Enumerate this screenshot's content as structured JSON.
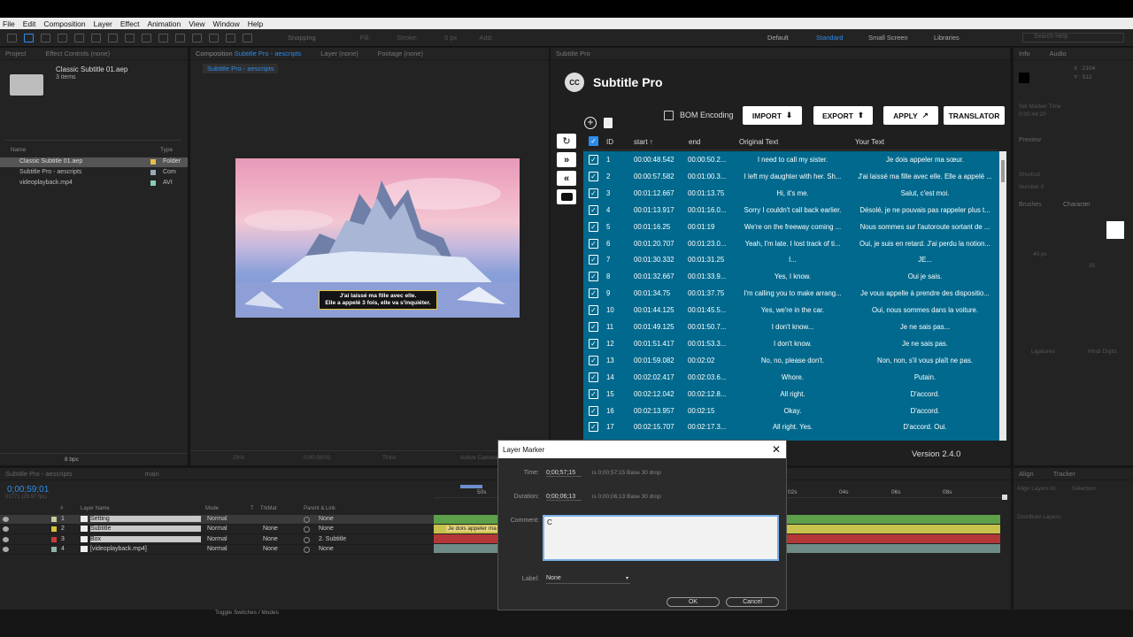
{
  "menu": [
    "File",
    "Edit",
    "Composition",
    "Layer",
    "Effect",
    "Animation",
    "View",
    "Window",
    "Help"
  ],
  "toolbar": {
    "snapping": "Snapping",
    "fill": "Fill:",
    "stroke": "Stroke:",
    "stroke_px": "0 px",
    "add": "Add:"
  },
  "workspaces": [
    "Default",
    "Standard",
    "Small Screen",
    "Libraries"
  ],
  "search_help": "Search Help",
  "project": {
    "tab": "Project",
    "tab2": "Effect Controls (none)",
    "comp_name": "Classic Subtitle 01.aep",
    "comp_items": "3 items",
    "col_name": "Name",
    "col_type": "Type",
    "items": [
      {
        "name": "Classic Subtitle 01.aep",
        "type": "Folder"
      },
      {
        "name": "Subtitle Pro - aescripts",
        "type": "Com"
      },
      {
        "name": "videoplayback.mp4",
        "type": "AVI"
      }
    ],
    "bpc": "8 bpc"
  },
  "viewer": {
    "tab_comp": "Composition",
    "tab_comp_name": "Subtitle Pro - aescripts",
    "tab_layer": "Layer (none)",
    "tab_footage": "Footage (none)",
    "breadcrumb": "Subtitle Pro - aescripts",
    "subtitle_line1": "J'ai laissé ma fille avec elle.",
    "subtitle_line2": "Elle a appelé 3 fois, elle va s'inquiéter.",
    "zoom": "25%",
    "timecode": "0;00;59;01",
    "res": "Third",
    "camera": "Active Camera"
  },
  "subtitle_pro": {
    "tab": "Subtitle Pro",
    "logo": "CC",
    "title": "Subtitle Pro",
    "bom": "BOM Encoding",
    "import": "IMPORT",
    "export": "EXPORT",
    "apply": "APPLY",
    "translator": "TRANSLATOR",
    "columns": {
      "id": "ID",
      "start": "start",
      "end": "end",
      "original": "Original Text",
      "yours": "Your Text"
    },
    "rows": [
      {
        "id": "1",
        "start": "00:00:48.542",
        "end": "00:00:50.2...",
        "orig": "I need to call my sister.",
        "tr": "Je dois appeler ma sœur."
      },
      {
        "id": "2",
        "start": "00:00:57.582",
        "end": "00:01:00.3...",
        "orig": "I left my daughter with her. Sh...",
        "tr": "J'ai laissé ma fille avec elle. Elle a appelé ..."
      },
      {
        "id": "3",
        "start": "00:01:12.667",
        "end": "00:01:13.75",
        "orig": "Hi, it's me.",
        "tr": "Salut, c'est moi."
      },
      {
        "id": "4",
        "start": "00:01:13.917",
        "end": "00:01:16.0...",
        "orig": "Sorry I couldn't call back earlier.",
        "tr": "Désolé, je ne pouvais pas rappeler plus t..."
      },
      {
        "id": "5",
        "start": "00:01:16.25",
        "end": "00:01:19",
        "orig": "We're on the freeway coming ...",
        "tr": "Nous sommes sur l'autoroute sortant de ..."
      },
      {
        "id": "6",
        "start": "00:01:20.707",
        "end": "00:01:23.0...",
        "orig": "Yeah, I'm late. I lost track of ti...",
        "tr": "Oui, je suis en retard. J'ai perdu la notion..."
      },
      {
        "id": "7",
        "start": "00:01:30.332",
        "end": "00:01:31.25",
        "orig": "I...",
        "tr": "JE..."
      },
      {
        "id": "8",
        "start": "00:01:32.667",
        "end": "00:01:33.9...",
        "orig": "Yes, I know.",
        "tr": "Oui je sais."
      },
      {
        "id": "9",
        "start": "00:01:34.75",
        "end": "00:01:37.75",
        "orig": "I'm calling you to make arrang...",
        "tr": "Je vous appelle à prendre des dispositio..."
      },
      {
        "id": "10",
        "start": "00:01:44.125",
        "end": "00:01:45.5...",
        "orig": "Yes, we're in the car.",
        "tr": "Oui, nous sommes dans la voiture."
      },
      {
        "id": "11",
        "start": "00:01:49.125",
        "end": "00:01:50.7...",
        "orig": "I don't know...",
        "tr": "Je ne sais pas..."
      },
      {
        "id": "12",
        "start": "00:01:51.417",
        "end": "00:01:53.3...",
        "orig": "I don't know.",
        "tr": "Je ne sais pas."
      },
      {
        "id": "13",
        "start": "00:01:59.082",
        "end": "00:02:02",
        "orig": "No, no, please don't.",
        "tr": "Non, non, s'il vous plaît ne pas."
      },
      {
        "id": "14",
        "start": "00:02:02.417",
        "end": "00:02:03.6...",
        "orig": "Whore.",
        "tr": "Putain."
      },
      {
        "id": "15",
        "start": "00:02:12.042",
        "end": "00:02:12.8...",
        "orig": "All right.",
        "tr": "D'accord."
      },
      {
        "id": "16",
        "start": "00:02:13.957",
        "end": "00:02:15",
        "orig": "Okay.",
        "tr": "D'accord."
      },
      {
        "id": "17",
        "start": "00:02:15.707",
        "end": "00:02:17.3...",
        "orig": "All right. Yes.",
        "tr": "D'accord. Oui."
      }
    ],
    "version": "Version 2.4.0"
  },
  "right_panels": {
    "info": "Info",
    "audio": "Audio",
    "x": "X : 2104",
    "y": "Y : 512",
    "marker_time": "Set Marker Time",
    "marker_val": "0;00;44;20",
    "preview": "Preview",
    "shortcut": "Shortcut",
    "number": "Number 0",
    "brushes": "Brushes",
    "character": "Character",
    "font_size": "40 px",
    "tracking": "35",
    "ligatures": "Ligatures",
    "hindi": "Hindi Digits",
    "align": "Align",
    "tracker": "Tracker",
    "align_to": "Align Layers to:",
    "selection": "Selection",
    "distribute": "Distribute Layers:"
  },
  "timeline": {
    "tab": "Subtitle Pro - aescripts",
    "tab2": "main",
    "time": "0;00;59;01",
    "fps": "01771 (29.97 fps)",
    "headers": {
      "num": "#",
      "name": "Layer Name",
      "mode": "Mode",
      "t": "T",
      "trkmat": "TrkMat",
      "parent": "Parent & Link"
    },
    "layers": [
      {
        "num": "1",
        "name": "Setting",
        "mode": "Normal",
        "trk": "",
        "parent": "None",
        "color": "#c9c9a0"
      },
      {
        "num": "2",
        "name": "Subtitle",
        "mode": "Normal",
        "trk": "None",
        "parent": "None",
        "color": "#d6c33a"
      },
      {
        "num": "3",
        "name": "Box",
        "mode": "Normal",
        "trk": "None",
        "parent": "2. Subtitle",
        "color": "#c63a3a"
      },
      {
        "num": "4",
        "name": "[videoplayback.mp4]",
        "mode": "Normal",
        "trk": "None",
        "parent": "None",
        "color": "#8fb3a8"
      }
    ],
    "ruler": [
      "50s",
      "02s",
      "04s",
      "06s",
      "08s"
    ],
    "clip_text": "Je dois appeler ma",
    "toggle": "Toggle Switches / Modes"
  },
  "dialog": {
    "title": "Layer Marker",
    "time_label": "Time:",
    "time_val": "0;00;57;15",
    "time_note": "is 0;00;57;15  Base 30  drop",
    "dur_label": "Duration:",
    "dur_val": "0;00;06;13",
    "dur_note": "is 0;00;06;13  Base 30  drop",
    "comment_label": "Comment:",
    "comment_val": "C",
    "label_label": "Label:",
    "label_val": "None",
    "ok": "OK",
    "cancel": "Cancel"
  }
}
